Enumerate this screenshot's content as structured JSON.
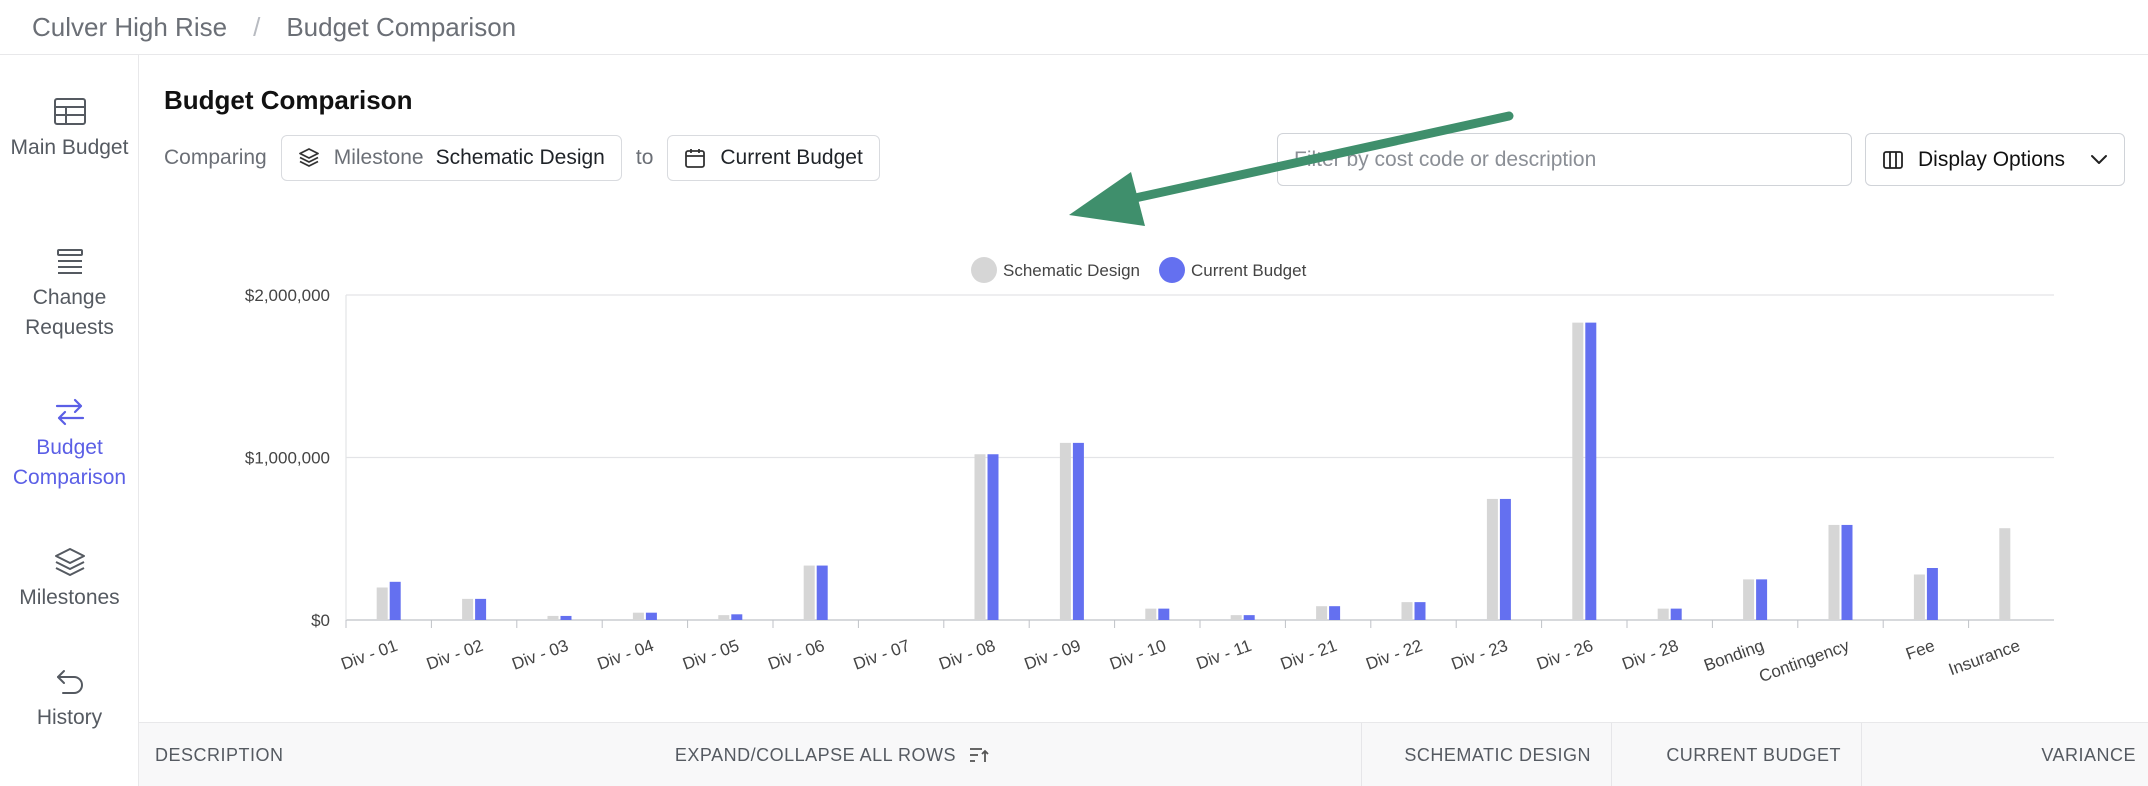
{
  "breadcrumb": {
    "project": "Culver High Rise",
    "separator": "/",
    "page": "Budget Comparison"
  },
  "sidebar": {
    "items": [
      {
        "label": "Main Budget",
        "icon": "table-icon",
        "active": false
      },
      {
        "label": "Change Requests",
        "icon": "list-icon",
        "active": false
      },
      {
        "label": "Budget Comparison",
        "icon": "swap-arrows-icon",
        "active": true
      },
      {
        "label": "Milestones",
        "icon": "layers-icon",
        "active": false
      },
      {
        "label": "History",
        "icon": "undo-arrow-icon",
        "active": false
      }
    ]
  },
  "page_title": "Budget Comparison",
  "compare": {
    "prefix": "Comparing",
    "source_type": "Milestone",
    "source_name": "Schematic Design",
    "connector": "to",
    "target_name": "Current Budget"
  },
  "filter": {
    "placeholder": "Filter by cost code or description",
    "value": ""
  },
  "display_options": {
    "label": "Display Options"
  },
  "colors": {
    "accent": "#5b5fe6",
    "series_a": "#d6d6d6",
    "series_b": "#6470f0",
    "arrow": "#3f8f6c"
  },
  "chart_data": {
    "type": "bar",
    "categories": [
      "Div - 01",
      "Div - 02",
      "Div - 03",
      "Div - 04",
      "Div - 05",
      "Div - 06",
      "Div - 07",
      "Div - 08",
      "Div - 09",
      "Div - 10",
      "Div - 11",
      "Div - 21",
      "Div - 22",
      "Div - 23",
      "Div - 26",
      "Div - 28",
      "Bonding",
      "Contingency",
      "Fee",
      "Insurance"
    ],
    "series": [
      {
        "name": "Schematic Design",
        "values": [
          200000,
          130000,
          25000,
          45000,
          30000,
          335000,
          0,
          1020000,
          1090000,
          70000,
          30000,
          85000,
          110000,
          745000,
          1830000,
          70000,
          250000,
          585000,
          280000,
          565000
        ]
      },
      {
        "name": "Current Budget",
        "values": [
          235000,
          130000,
          25000,
          45000,
          35000,
          335000,
          0,
          1020000,
          1090000,
          70000,
          30000,
          85000,
          110000,
          745000,
          1830000,
          70000,
          250000,
          585000,
          320000,
          0
        ]
      }
    ],
    "y_ticks": [
      "$0",
      "$1,000,000",
      "$2,000,000"
    ],
    "ylim": [
      0,
      2000000
    ],
    "legend": "top-center",
    "grid": true
  },
  "table": {
    "columns": {
      "description": "DESCRIPTION",
      "expand": "EXPAND/COLLAPSE ALL ROWS",
      "schematic": "SCHEMATIC DESIGN",
      "current": "CURRENT BUDGET",
      "variance": "VARIANCE"
    }
  }
}
